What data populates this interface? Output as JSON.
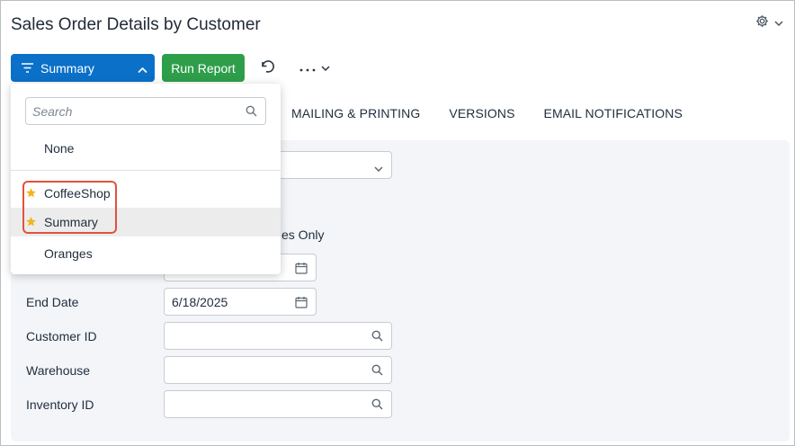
{
  "page": {
    "title": "Sales Order Details by Customer"
  },
  "toolbar": {
    "summary_label": "Summary",
    "run_label": "Run Report"
  },
  "tabs": [
    {
      "label": "MAILING & PRINTING"
    },
    {
      "label": "VERSIONS"
    },
    {
      "label": "EMAIL NOTIFICATIONS"
    }
  ],
  "dropdown": {
    "search_placeholder": "Search",
    "items": [
      {
        "label": "None",
        "starred": false
      },
      {
        "label": "CoffeeShop",
        "starred": true
      },
      {
        "label": "Summary",
        "starred": true,
        "selected": true
      },
      {
        "label": "Oranges",
        "starred": false
      }
    ]
  },
  "form": {
    "partial_option_text": "es Only",
    "end_date_label": "End Date",
    "end_date_value": "6/18/2025",
    "customer_id_label": "Customer ID",
    "warehouse_label": "Warehouse",
    "inventory_id_label": "Inventory ID"
  },
  "colors": {
    "primary_blue": "#0a70c8",
    "run_green": "#2e9e4a",
    "star_yellow": "#f2b51d",
    "highlight_red": "#e0533c"
  }
}
